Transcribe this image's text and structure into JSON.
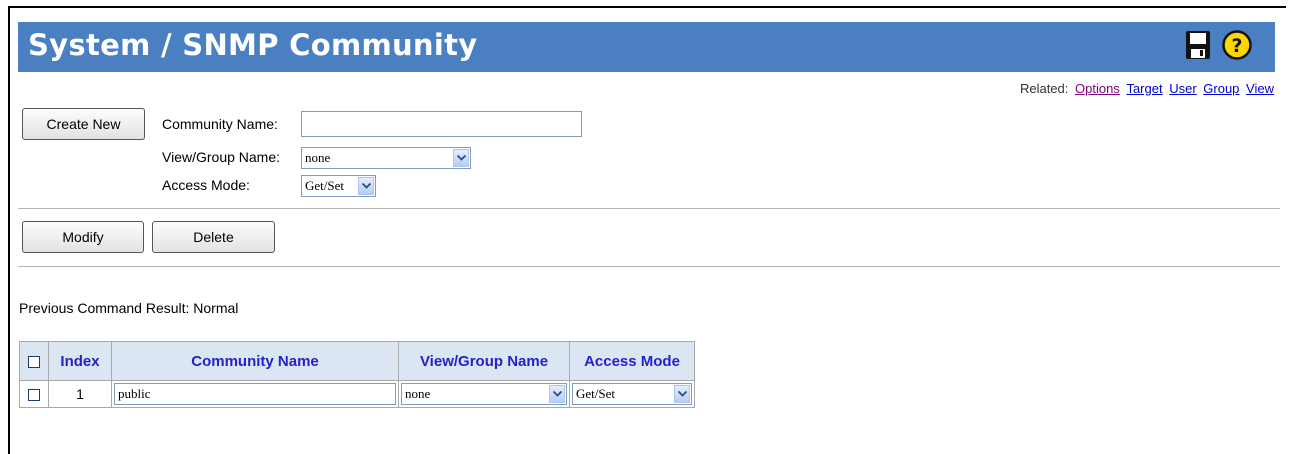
{
  "header": {
    "title": "System / SNMP Community",
    "save_icon": "floppy-disk-icon",
    "help_icon": "question-mark-icon"
  },
  "related": {
    "label": "Related:",
    "links": [
      "Options",
      "Target",
      "User",
      "Group",
      "View"
    ]
  },
  "form": {
    "create_button": "Create New",
    "community_name_label": "Community Name:",
    "community_name_value": "",
    "view_group_label": "View/Group Name:",
    "view_group_value": "none",
    "access_mode_label": "Access Mode:",
    "access_mode_value": "Get/Set"
  },
  "actions": {
    "modify_button": "Modify",
    "delete_button": "Delete"
  },
  "result": "Previous Command Result: Normal",
  "table": {
    "headers": [
      "Index",
      "Community Name",
      "View/Group Name",
      "Access Mode"
    ],
    "rows": [
      {
        "index": "1",
        "community_name": "public",
        "view_group": "none",
        "access_mode": "Get/Set"
      }
    ]
  },
  "colors": {
    "header_bg": "#4a7fc1",
    "table_header_bg": "#dce6f2",
    "table_header_text": "#2222cc"
  }
}
